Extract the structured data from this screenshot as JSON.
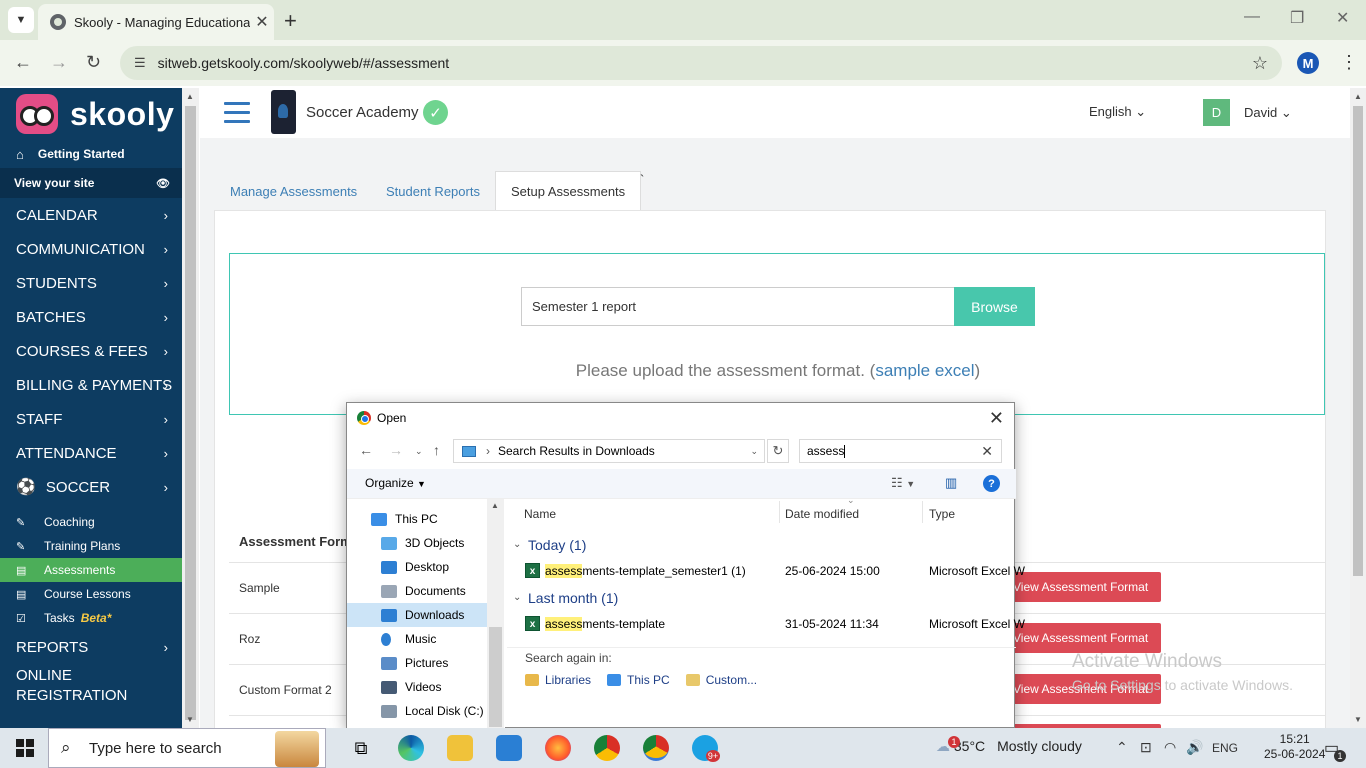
{
  "browser": {
    "tab_title": "Skooly - Managing Educational",
    "tab_close": "✕",
    "new_tab": "+",
    "url": "sitweb.getskooly.com/skoolyweb/#/assessment",
    "profile_initial": "M"
  },
  "sidebar": {
    "logo_text": "skooly",
    "getting_started": "Getting Started",
    "view_site": "View your site",
    "menu": [
      {
        "label": "CALENDAR"
      },
      {
        "label": "COMMUNICATION"
      },
      {
        "label": "STUDENTS"
      },
      {
        "label": "BATCHES"
      },
      {
        "label": "COURSES & FEES"
      },
      {
        "label": "BILLING & PAYMENTS"
      },
      {
        "label": "STAFF"
      },
      {
        "label": "ATTENDANCE"
      }
    ],
    "soccer": "SOCCER",
    "sub": [
      {
        "label": "Coaching"
      },
      {
        "label": "Training Plans"
      },
      {
        "label": "Assessments"
      },
      {
        "label": "Course Lessons"
      },
      {
        "label": "Tasks"
      }
    ],
    "beta": "Beta*",
    "reports": "REPORTS",
    "online_registration_1": "ONLINE",
    "online_registration_2": "REGISTRATION"
  },
  "header": {
    "school_name": "Soccer Academy",
    "language": "English",
    "user_initial": "D",
    "user_name": "David"
  },
  "tabs": {
    "manage": "Manage Assessments",
    "reports": "Student Reports",
    "setup": "Setup Assessments",
    "tick": "`"
  },
  "upload": {
    "file_value": "Semester 1 report",
    "browse": "Browse",
    "hint_prefix": "Please upload the assessment format. (",
    "hint_link": "sample excel",
    "hint_suffix": ")"
  },
  "table": {
    "header": "Assessment Forma",
    "rows": [
      {
        "name": "Sample",
        "action": "View Assessment Format"
      },
      {
        "name": "Roz",
        "action": "View Assessment Format"
      },
      {
        "name": "Custom Format 2",
        "action": "View Assessment Format"
      }
    ]
  },
  "watermark": {
    "line1": "Activate Windows",
    "line2": "Go to Settings to activate Windows."
  },
  "dialog": {
    "title": "Open",
    "path": "Search Results in Downloads",
    "search_value": "assess",
    "organize": "Organize",
    "help": "?",
    "tree": [
      {
        "label": "This PC",
        "color": "#3a8ee6"
      },
      {
        "label": "3D Objects",
        "color": "#58a9e8"
      },
      {
        "label": "Desktop",
        "color": "#2d7fd3"
      },
      {
        "label": "Documents",
        "color": "#9aa6b5"
      },
      {
        "label": "Downloads",
        "color": "#2d7fd3"
      },
      {
        "label": "Music",
        "color": "#2d7fd3"
      },
      {
        "label": "Pictures",
        "color": "#5a8cc8"
      },
      {
        "label": "Videos",
        "color": "#455a74"
      },
      {
        "label": "Local Disk (C:)",
        "color": "#8596a8"
      }
    ],
    "columns": {
      "name": "Name",
      "date": "Date modified",
      "type": "Type"
    },
    "groups": [
      {
        "label": "Today (1)",
        "files": [
          {
            "highlight": "assess",
            "rest": "ments-template_semester1 (1)",
            "date": "25-06-2024 15:00",
            "type": "Microsoft Excel W"
          }
        ]
      },
      {
        "label": "Last month (1)",
        "files": [
          {
            "highlight": "assess",
            "rest": "ments-template",
            "date": "31-05-2024 11:34",
            "type": "Microsoft Excel W"
          }
        ]
      }
    ],
    "search_again": "Search again in:",
    "search_locations": [
      "Libraries",
      "This PC",
      "Custom..."
    ]
  },
  "taskbar": {
    "search_placeholder": "Type here to search",
    "temperature": "35°C",
    "weather": "Mostly cloudy",
    "weather_badge": "1",
    "language": "ENG",
    "time": "15:21",
    "date": "25-06-2024",
    "notif_badge": "1",
    "skype_badge": "9+"
  },
  "colors": {
    "sidebar_bg": "#0d3c61",
    "active_green": "#4cae59",
    "browse_teal": "#48c7ac",
    "danger_red": "#dc4a55",
    "link_blue": "#3d7fb5"
  }
}
